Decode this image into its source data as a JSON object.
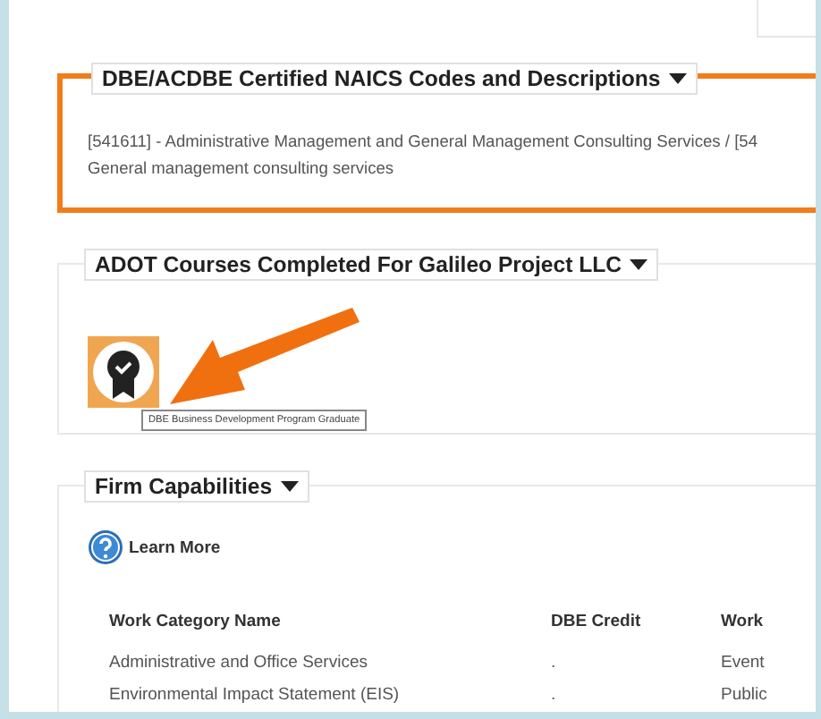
{
  "sections": [
    {
      "title": "DBE/ACDBE Certified NAICS Codes and Descriptions",
      "highlighted": true,
      "kind": "text",
      "text": "[541611] - Administrative Management and General Management Consulting Services / [54\nGeneral management consulting services"
    },
    {
      "title": "ADOT Courses Completed For Galileo Project LLC",
      "highlighted": false,
      "kind": "badges",
      "badges": [
        {
          "tooltip": "DBE Business Development Program Graduate"
        }
      ]
    },
    {
      "title": "Firm Capabilities",
      "highlighted": false,
      "kind": "table",
      "link": "Learn More",
      "columns": [
        "Work Category Name",
        "DBE Credit",
        "Work"
      ],
      "rows": [
        [
          "Administrative and Office Services",
          ".",
          "Event"
        ],
        [
          "Environmental Impact Statement (EIS)",
          ".",
          "Public"
        ]
      ]
    }
  ]
}
